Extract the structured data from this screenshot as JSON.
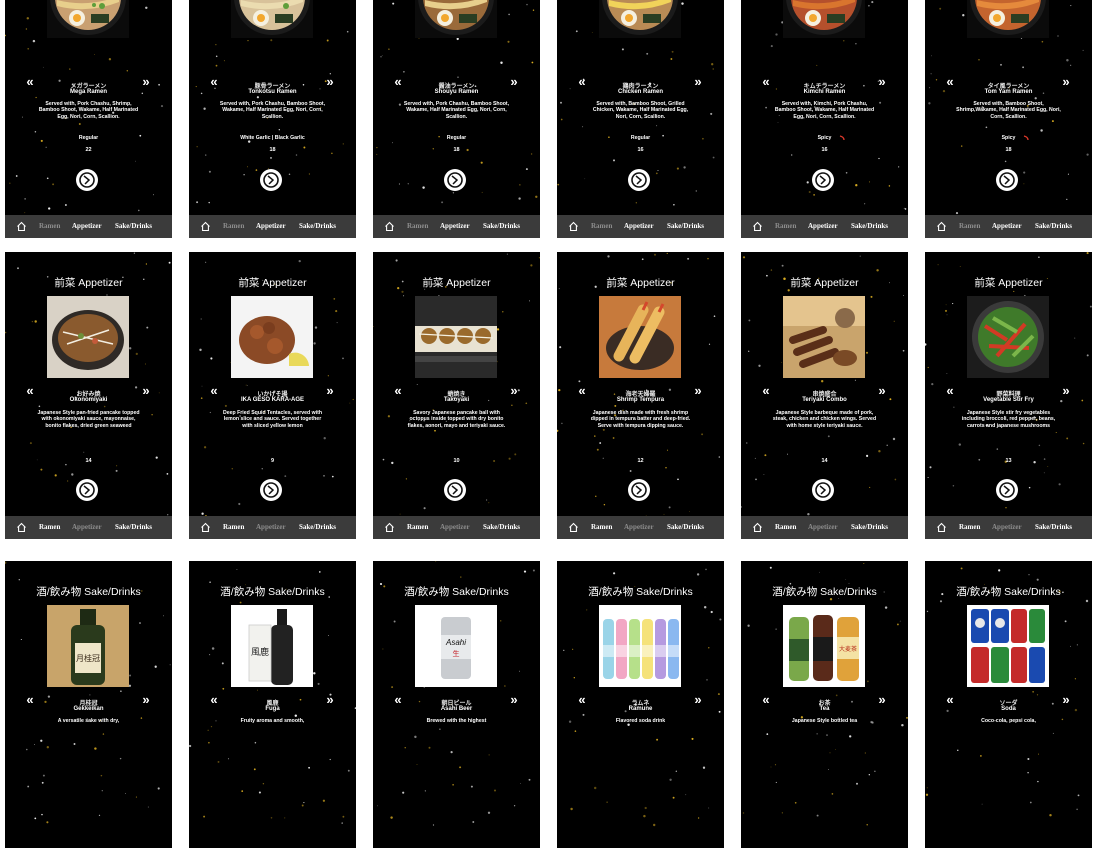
{
  "nav": {
    "ramen": "Ramen",
    "appetizer": "Appetizer",
    "sake_drinks": "Sake/Drinks"
  },
  "colors": {
    "background": "#000000",
    "navbar": "#3b3b3b",
    "active_tab": "#ffffff",
    "inactive_tab": "#8d8d8d",
    "sparkle": "#e8b823",
    "spicy": "#e0392b"
  },
  "icons": {
    "prev": "double-chevron-left-icon",
    "next": "double-chevron-right-icon",
    "home": "home-icon",
    "logo": "restaurant-logo-icon"
  },
  "ramen": {
    "items": [
      {
        "jp": "メガラーメン",
        "name": "Mega Ramen",
        "description": "Served with, Pork Chashu, Shrimp, Bamboo Shoot, Wakame, Half Marinated Egg, Nori, Corn, Scallion.",
        "option": "Regular",
        "price": "22"
      },
      {
        "jp": "豚骨ラーメン",
        "name": "Tonkotsu Ramen",
        "description": "Served with, Pork Chashu, Bamboo Shoot, Wakame, Half Marinated Egg, Nori, Corn, Scallion.",
        "option": "White Garlic | Black Garlic",
        "price": "18"
      },
      {
        "jp": "醤油ラーメン",
        "name": "Shouyu Ramen",
        "description": "Served with, Pork Chashu, Bamboo Shoot, Wakame, Half Marinated Egg, Nori, Corn, Scallion.",
        "option": "Regular",
        "price": "18"
      },
      {
        "jp": "鶏肉ラーメン",
        "name": "Chicken Ramen",
        "description": "Served with, Bamboo Shoot, Grilled Chicken, Wakame, Half Marinated Egg, Nori, Corn, Scallion.",
        "option": "Regular",
        "price": "16"
      },
      {
        "jp": "キムチラーメン",
        "name": "Kimchi Ramen",
        "description": "Served with, Kimchi, Pork Chashu, Bamboo Shoot, Wakame, Half Marinated Egg, Nori, Corn, Scallion.",
        "option": "Spicy",
        "price": "16"
      },
      {
        "jp": "タイ風ラーメン",
        "name": "Tom Yam Ramen",
        "description": "Served with, Bamboo Shoot, Shrimp,Wakame, Half Marinated Egg, Nori, Corn, Scallion.",
        "option": "Spicy",
        "price": "18"
      }
    ]
  },
  "appetizer": {
    "title": "前菜 Appetizer",
    "items": [
      {
        "jp": "お好み焼",
        "name": "Okonomiyaki",
        "description": "Japanese Style pan-fried pancake topped with okonomiyaki sauce, mayonnaise, bonito flakes, dried green seaweed",
        "price": "14"
      },
      {
        "jp": "いかげそ揚",
        "name": "IKA GESO KARA-AGE",
        "description": "Deep Fried Squid Tentacles, served with lemon slice and sauce. Served together with sliced yellow lemon",
        "price": "9"
      },
      {
        "jp": "蛸焼き",
        "name": "Takoyaki",
        "description": "Savory Japanese pancake ball with octopus inside topped with dry bonito flakes, aonori, mayo and teriyaki sauce.",
        "price": "10"
      },
      {
        "jp": "海老天婦羅",
        "name": "Shrimp Tempura",
        "description": "Japanese dish made with fresh shrimp dipped in tempura batter and deep-fried. Serve with tempura dipping sauce.",
        "price": "12"
      },
      {
        "jp": "串焼盛合",
        "name": "Teriyaki Combo",
        "description": "Japanese Style barbeque made of pork, steak, chicken and chicken wings. Served with home style teriyaki sauce.",
        "price": "14"
      },
      {
        "jp": "野菜料理",
        "name": "Vegetable Stir Fry",
        "description": "Japanese Style stir fry vegetables including broccoli, red pepper, beans, carrots and japanese mushrooms",
        "price": "13"
      }
    ]
  },
  "drinks": {
    "title": "酒/飲み物 Sake/Drinks",
    "items": [
      {
        "jp": "月桂冠",
        "name": "Gekkeikan",
        "description": "A versatile sake with dry,"
      },
      {
        "jp": "風鹿",
        "name": "Fuga",
        "description": "Fruity aroma and smooth,"
      },
      {
        "jp": "朝日ビール",
        "name": "Asahi Beer",
        "description": "Brewed with the highest"
      },
      {
        "jp": "ラムネ",
        "name": "Ramune",
        "description": "Flavored soda drink"
      },
      {
        "jp": "お茶",
        "name": "Tea",
        "description": "Japanese Style bottled tea"
      },
      {
        "jp": "ソーダ",
        "name": "Soda",
        "description": "Coco-cola, pepsi cola,"
      }
    ],
    "labels": {
      "gekkeikan": "月桂冠",
      "fuga": "風鹿",
      "asahi": "Asahi",
      "asahi_sub": "生",
      "tea": "大麦茶"
    }
  }
}
